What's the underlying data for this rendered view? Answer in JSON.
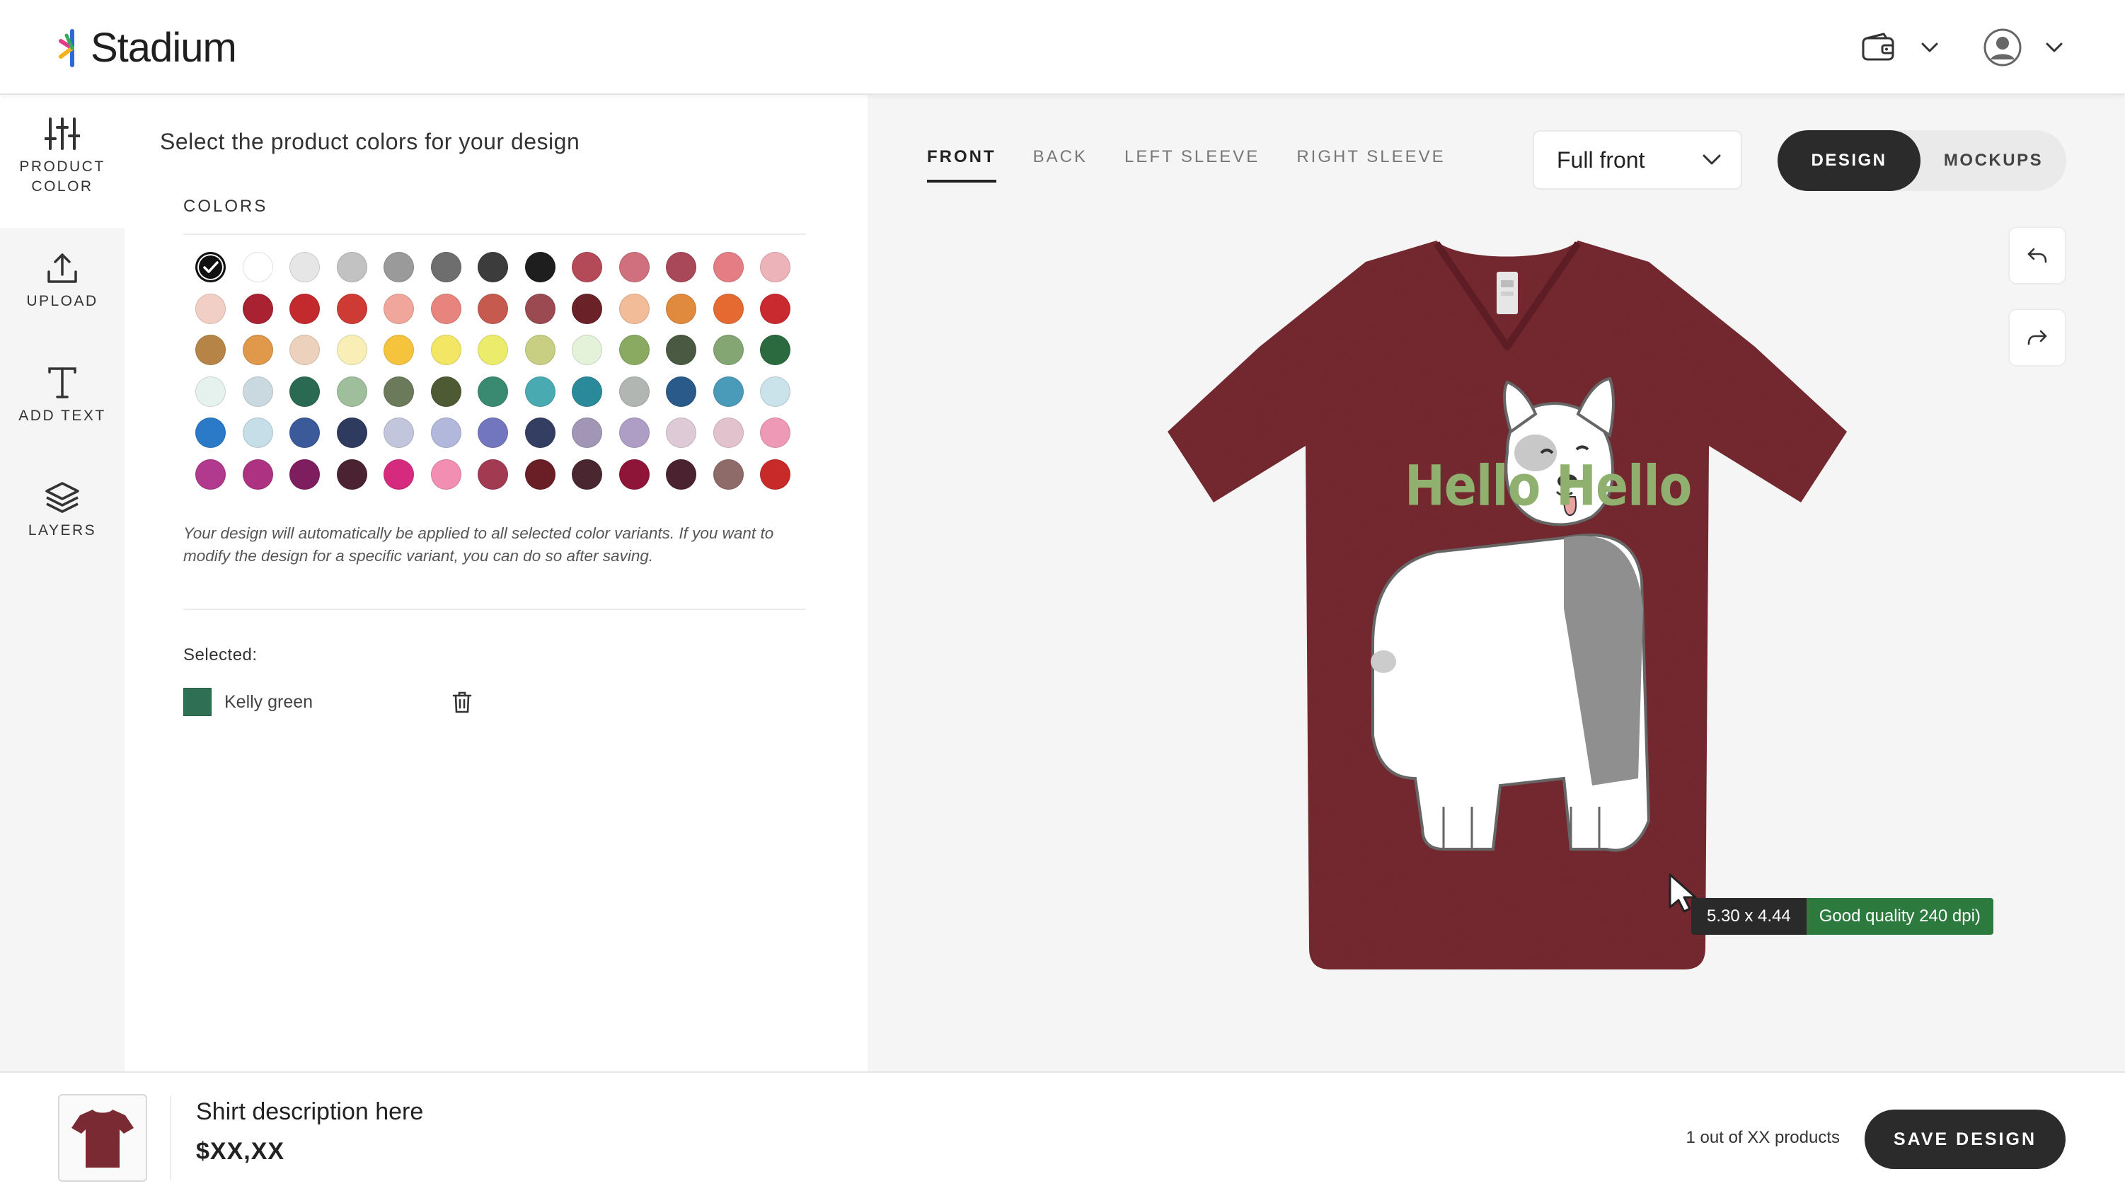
{
  "header": {
    "app_name": "Stadium",
    "icons": [
      "wallet-icon",
      "chevron-down-icon",
      "user-avatar-icon",
      "chevron-down-icon"
    ]
  },
  "rail": {
    "items": [
      {
        "label": "PRODUCT COLOR",
        "icon": "sliders-icon",
        "active": true
      },
      {
        "label": "UPLOAD",
        "icon": "upload-icon",
        "active": false
      },
      {
        "label": "ADD TEXT",
        "icon": "text-icon",
        "active": false
      },
      {
        "label": "LAYERS",
        "icon": "layers-icon",
        "active": false
      }
    ]
  },
  "panel": {
    "title": "Select the product colors for your design",
    "colors_label": "COLORS",
    "swatches": [
      "#111111",
      "#ffffff",
      "#e6e6e6",
      "#c2c2c2",
      "#9a9a9a",
      "#6e6e6e",
      "#3c3c3c",
      "#1e1e1e",
      "#b44a58",
      "#d0707e",
      "#a84858",
      "#e47e84",
      "#ecb4b8",
      "#f2cfc4",
      "#a82232",
      "#c32a2e",
      "#ce3a34",
      "#f0a69a",
      "#e7847e",
      "#c65a4e",
      "#9a4a50",
      "#6a2228",
      "#f2bc98",
      "#e08a3e",
      "#e46a32",
      "#c82a30",
      "#b58446",
      "#e0984a",
      "#ecd2bc",
      "#f8eeb6",
      "#f6c43c",
      "#f2e664",
      "#ecec6c",
      "#c8ce82",
      "#e4f2da",
      "#8aaa62",
      "#4a5a42",
      "#84a672",
      "#2a6a3e",
      "#e6f2ee",
      "#cad8e0",
      "#2a6a52",
      "#9ebe9c",
      "#6a7a5a",
      "#4e5a34",
      "#3a8a72",
      "#4aaab2",
      "#2a8a9a",
      "#b2b6b2",
      "#2a5a8a",
      "#4a9aba",
      "#cae2ea",
      "#2a7ac8",
      "#c6dee8",
      "#3a5a9a",
      "#2e3a5e",
      "#c2c6dc",
      "#b2b8dc",
      "#7276be",
      "#343e62",
      "#a296b6",
      "#ae9ec6",
      "#decad6",
      "#e2c2cc",
      "#ee9ab6",
      "#b23a8e",
      "#ae3282",
      "#7e1e5e",
      "#4a2232",
      "#d62a7e",
      "#f28eb2",
      "#a23a52",
      "#6a1e26",
      "#4a2630",
      "#8e1438",
      "#4a2230",
      "#8e6a68",
      "#c82a2a"
    ],
    "selected_index": 0,
    "note": "Your design will automatically be applied to all selected color variants. If you want to modify the design for a specific variant, you can do so after saving.",
    "selected_label": "Selected:",
    "selected": [
      {
        "name": "Kelly green",
        "color": "#2f6f54"
      }
    ]
  },
  "canvas": {
    "tabs": [
      {
        "label": "FRONT",
        "active": true
      },
      {
        "label": "BACK",
        "active": false
      },
      {
        "label": "LEFT SLEEVE",
        "active": false
      },
      {
        "label": "RIGHT SLEEVE",
        "active": false
      }
    ],
    "placement": "Full front",
    "toggle": {
      "on": "DESIGN",
      "off": "MOCKUPS"
    },
    "shirt_color": "#7a2a32",
    "design_text": "Hello Hello",
    "design_text_color": "#8fb06e",
    "print_size": "5.30 x 4.44",
    "quality": "Good quality 240 dpi)",
    "quality_color": "#2d7a3e"
  },
  "footer": {
    "description": "Shirt description here",
    "price": "$XX,XX",
    "count": "1 out of XX products",
    "save_label": "SAVE DESIGN"
  }
}
